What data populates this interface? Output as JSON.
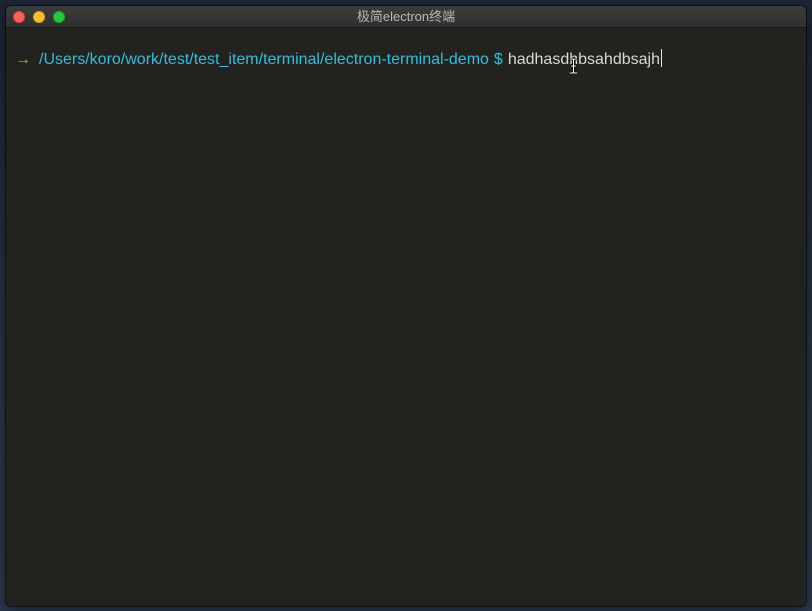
{
  "window": {
    "title": "极简electron终端"
  },
  "terminal": {
    "prompt_arrow": "→",
    "cwd": "/Users/koro/work/test/test_item/terminal/electron-terminal-demo",
    "prompt_symbol": "$",
    "input": "hadhasdhbsahdbsajh"
  },
  "colors": {
    "terminal_bg": "#22231f",
    "arrow": "#88c93f",
    "cwd": "#2fbfde",
    "input_text": "#d8d8d8"
  },
  "icons": {
    "close": "close-traffic-light",
    "minimize": "minimize-traffic-light",
    "maximize": "maximize-traffic-light",
    "mouse_cursor": "ibeam-cursor-icon"
  }
}
